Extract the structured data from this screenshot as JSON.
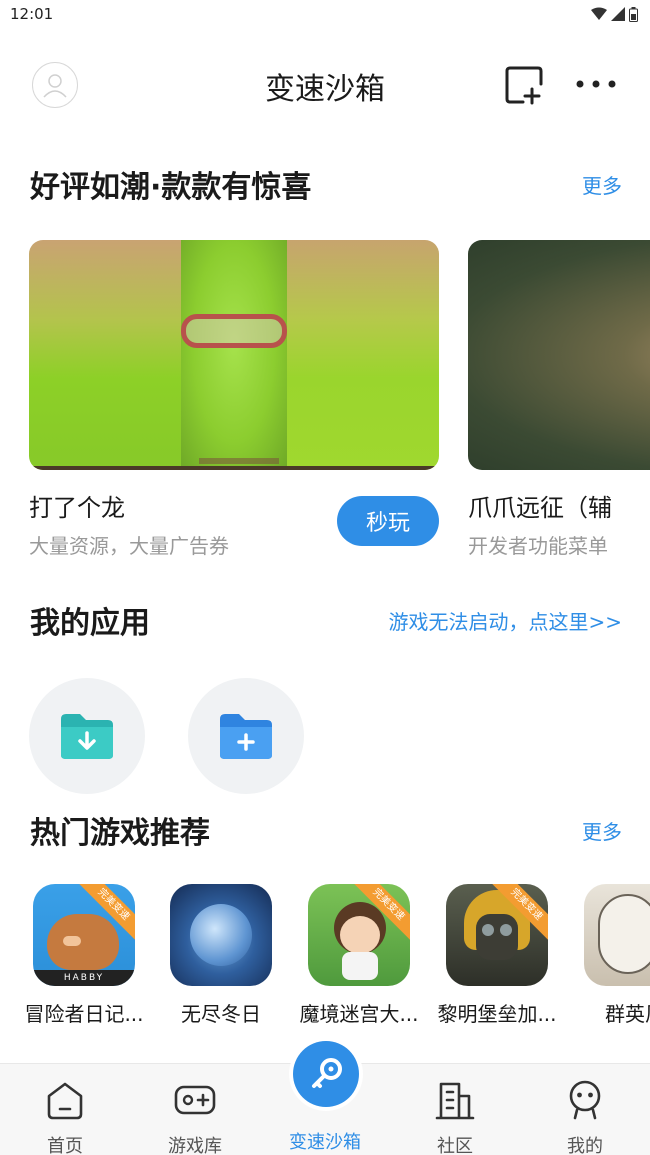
{
  "status_bar": {
    "time": "12:01"
  },
  "header": {
    "title": "变速沙箱"
  },
  "featured": {
    "title": "好评如潮·款款有惊喜",
    "more_label": "更多",
    "cards": [
      {
        "name": "打了个龙",
        "desc": "大量资源，大量广告券",
        "play_label": "秒玩"
      },
      {
        "name": "爪爪远征（辅",
        "desc": "开发者功能菜单"
      }
    ]
  },
  "my_apps": {
    "title": "我的应用",
    "help_link": "游戏无法启动，点这里>>"
  },
  "hot_games": {
    "title": "热门游戏推荐",
    "more_label": "更多",
    "items": [
      {
        "name": "冒险者日记...",
        "badge": "完美变速",
        "icon_text": "HABBY"
      },
      {
        "name": "无尽冬日"
      },
      {
        "name": "魔境迷宫大...",
        "badge": "完美变速"
      },
      {
        "name": "黎明堡垒加...",
        "badge": "完美变速"
      },
      {
        "name": "群英风"
      }
    ]
  },
  "tab_bar": {
    "tabs": [
      {
        "label": "首页"
      },
      {
        "label": "游戏库"
      },
      {
        "label": "变速沙箱"
      },
      {
        "label": "社区"
      },
      {
        "label": "我的"
      }
    ],
    "active_color": "#2f8ee6"
  },
  "colors": {
    "accent": "#2f8ee6",
    "secondary_text": "#999999"
  }
}
